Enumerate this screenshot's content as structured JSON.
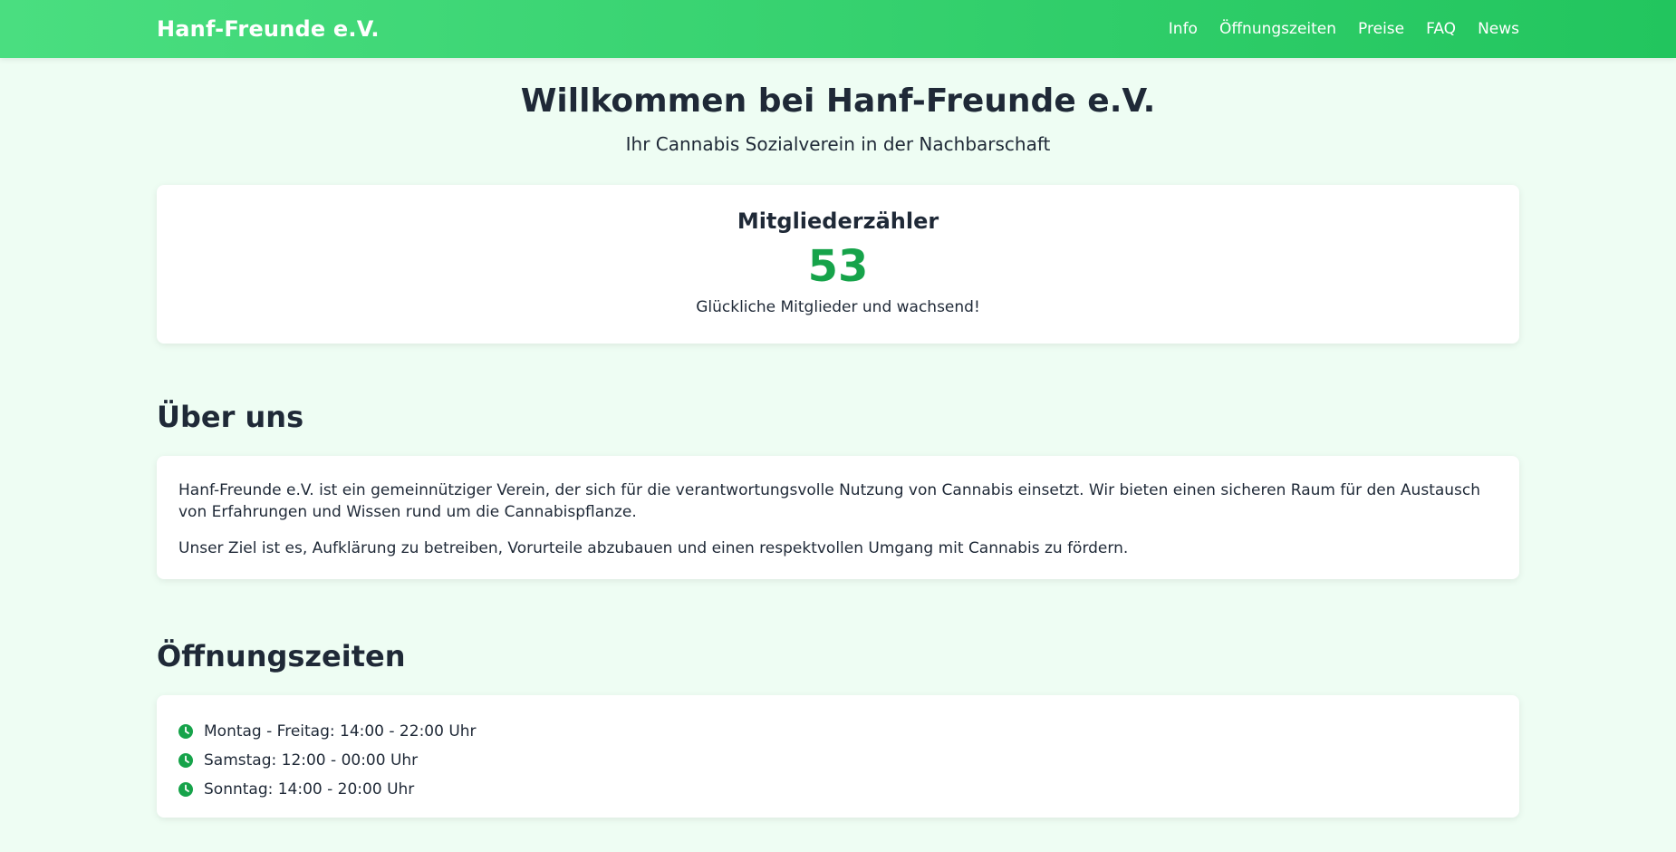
{
  "header": {
    "brand": "Hanf-Freunde e.V.",
    "nav": [
      {
        "label": "Info"
      },
      {
        "label": "Öffnungszeiten"
      },
      {
        "label": "Preise"
      },
      {
        "label": "FAQ"
      },
      {
        "label": "News"
      }
    ]
  },
  "hero": {
    "title": "Willkommen bei Hanf-Freunde e.V.",
    "subtitle": "Ihr Cannabis Sozialverein in der Nachbarschaft"
  },
  "counter": {
    "title": "Mitgliederzähler",
    "value": "53",
    "caption": "Glückliche Mitglieder und wachsend!"
  },
  "about": {
    "title": "Über uns",
    "paragraphs": [
      "Hanf-Freunde e.V. ist ein gemeinnütziger Verein, der sich für die verantwortungsvolle Nutzung von Cannabis einsetzt. Wir bieten einen sicheren Raum für den Austausch von Erfahrungen und Wissen rund um die Cannabispflanze.",
      "Unser Ziel ist es, Aufklärung zu betreiben, Vorurteile abzubauen und einen respektvollen Umgang mit Cannabis zu fördern."
    ]
  },
  "hours": {
    "title": "Öffnungszeiten",
    "icon": "clock-icon",
    "items": [
      "Montag - Freitag: 14:00 - 22:00 Uhr",
      "Samstag: 12:00 - 00:00 Uhr",
      "Sonntag: 14:00 - 20:00 Uhr"
    ]
  },
  "colors": {
    "header_gradient_start": "#4ade80",
    "header_gradient_end": "#22c55e",
    "accent": "#16a34a",
    "page_background": "#eefdf3",
    "text": "#1f2937"
  }
}
